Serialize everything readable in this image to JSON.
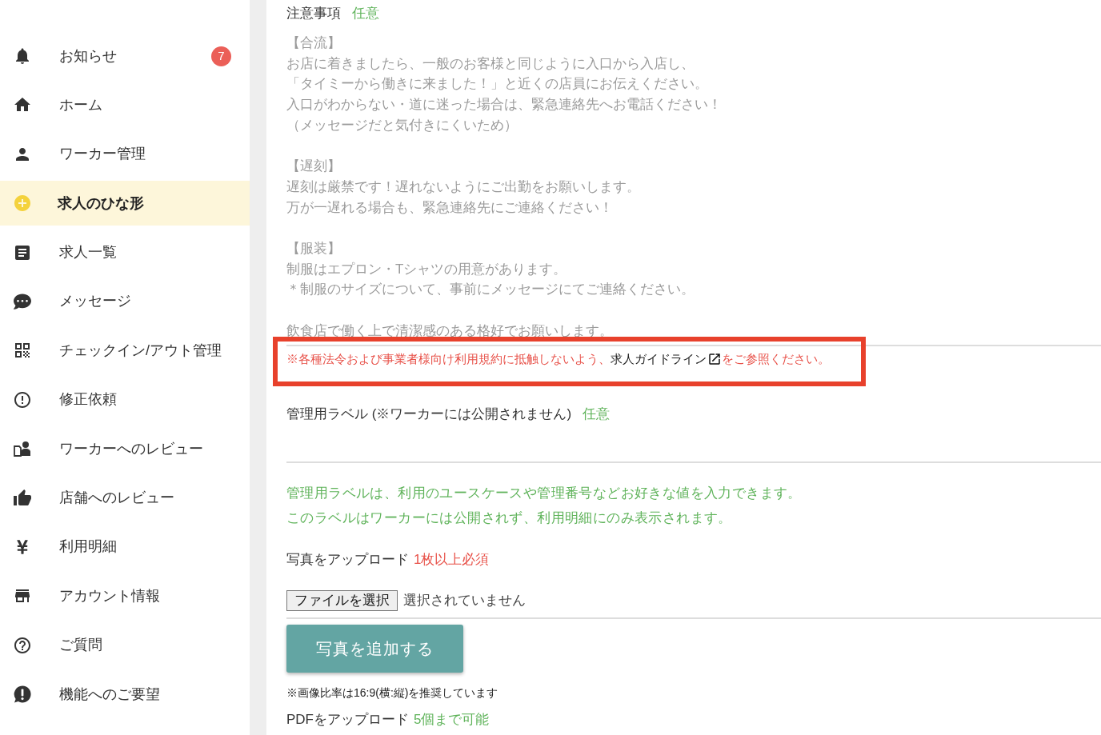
{
  "sidebar": {
    "items": [
      {
        "label": "お知らせ",
        "selected": false,
        "badge": "7"
      },
      {
        "label": "ホーム",
        "selected": false
      },
      {
        "label": "ワーカー管理",
        "selected": false
      },
      {
        "label": "求人のひな形",
        "selected": true
      },
      {
        "label": "求人一覧",
        "selected": false
      },
      {
        "label": "メッセージ",
        "selected": false
      },
      {
        "label": "チェックイン/アウト管理",
        "selected": false
      },
      {
        "label": "修正依頼",
        "selected": false
      },
      {
        "label": "ワーカーへのレビュー",
        "selected": false
      },
      {
        "label": "店舗へのレビュー",
        "selected": false
      },
      {
        "label": "利用明細",
        "selected": false
      },
      {
        "label": "アカウント情報",
        "selected": false
      },
      {
        "label": "ご質問",
        "selected": false
      },
      {
        "label": "機能へのご要望",
        "selected": false
      }
    ]
  },
  "notes_field": {
    "label": "注意事項",
    "tag": {
      "text": "任意",
      "kind": "optional"
    },
    "paragraphs": [
      {
        "lines": [
          "【合流】",
          "お店に着きましたら、一般のお客様と同じように入口から入店し、",
          "「タイミーから働きに来ました！」と近くの店員にお伝えください。",
          "入口がわからない・道に迷った場合は、緊急連絡先へお電話ください！",
          "（メッセージだと気付きにくいため）"
        ]
      },
      {
        "lines": [
          "【遅刻】",
          "遅刻は厳禁です！遅れないようにご出勤をお願いします。",
          "万が一遅れる場合も、緊急連絡先にご連絡ください！"
        ]
      },
      {
        "lines": [
          "【服装】",
          "制服はエプロン・Tシャツの用意があります。",
          "＊制服のサイズについて、事前にメッセージにてご連絡ください。"
        ]
      },
      {
        "lines": [
          "飲食店で働く上で清潔感のある格好でお願いします。"
        ]
      }
    ]
  },
  "notice": {
    "before": "※各種法令および事業者様向け利用規約に抵触しないよう、",
    "link": "求人ガイドライン",
    "after": "をご参照ください。"
  },
  "management_label_field": {
    "label": "管理用ラベル (※ワーカーには公開されません)",
    "tag": {
      "text": "任意",
      "kind": "optional"
    },
    "help": [
      "管理用ラベルは、利用のユースケースや管理番号などお好きな値を入力できます。",
      "このラベルはワーカーには公開されず、利用明細にのみ表示されます。"
    ]
  },
  "photo_upload": {
    "label": "写真をアップロード",
    "tag": {
      "text": "1枚以上必須",
      "kind": "required"
    },
    "file_button": "ファイルを選択",
    "file_status": "選択されていません",
    "add_button": "写真を追加する",
    "note": "※画像比率は16:9(横:縦)を推奨しています"
  },
  "pdf_upload": {
    "label": "PDFをアップロード",
    "tag": {
      "text": "5個まで可能",
      "kind": "optional"
    }
  }
}
